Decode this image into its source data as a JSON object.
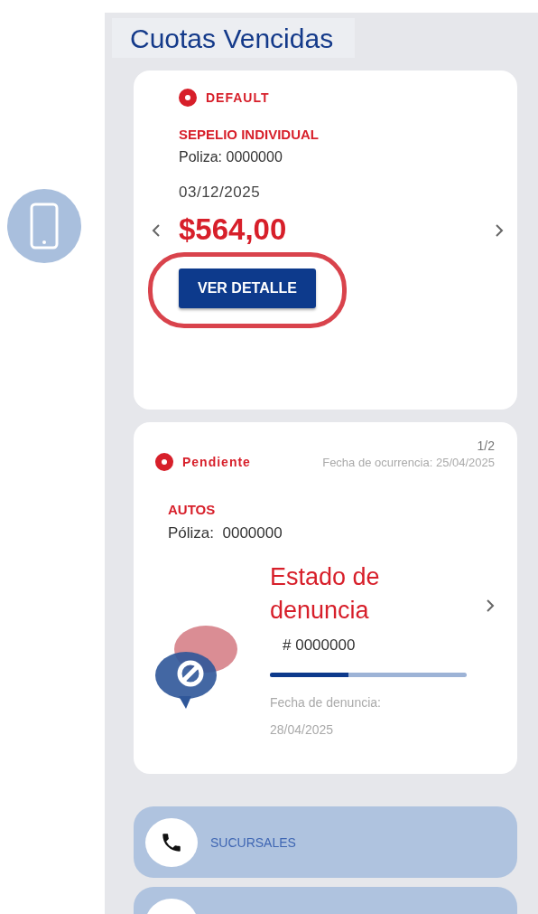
{
  "title": "Cuotas Vencidas",
  "overdue_card": {
    "status": {
      "label": "DEFAULT",
      "color": "#d71f2a"
    },
    "product": "SEPELIO INDIVIDUAL",
    "policy_label": "Poliza:",
    "policy_number": "0000000",
    "date": "03/12/2025",
    "amount": "$564,00",
    "button": "VER DETALLE",
    "highlighted": true
  },
  "claim_card": {
    "pager": "1/2",
    "status": {
      "label": "Pendiente",
      "color": "#d71f2a"
    },
    "occurrence": "Fecha de ocurrencia: 25/04/2025",
    "product": "AUTOS",
    "policy_label": "Póliza:",
    "policy_number": "0000000",
    "claim_title": "Estado de denuncia",
    "claim_number": "# 0000000",
    "progress": {
      "level": 0.4
    },
    "report_label": "Fecha de denuncia:",
    "report_date": "28/04/2025"
  },
  "links": [
    {
      "label": "SUCURSALES",
      "kind": "phone"
    },
    {
      "kind": "loading"
    }
  ]
}
